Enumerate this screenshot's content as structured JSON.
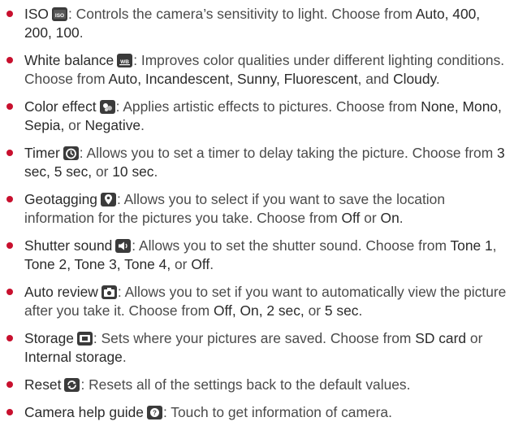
{
  "items": [
    {
      "term": "ISO",
      "icon": "iso-icon",
      "segments": [
        {
          "t": ": Controls the camera’s sensitivity to light. Choose from ",
          "b": false
        },
        {
          "t": "Auto, 400, 200, 100",
          "b": true
        },
        {
          "t": ".",
          "b": false
        }
      ]
    },
    {
      "term": "White balance",
      "icon": "white-balance-icon",
      "segments": [
        {
          "t": ": Improves color qualities under different lighting conditions. Choose from ",
          "b": false
        },
        {
          "t": "Auto, Incandescent, Sunny, Fluorescent",
          "b": true
        },
        {
          "t": ", and ",
          "b": false
        },
        {
          "t": "Cloudy",
          "b": true
        },
        {
          "t": ".",
          "b": false
        }
      ]
    },
    {
      "term": "Color effect",
      "icon": "color-effect-icon",
      "segments": [
        {
          "t": ": Applies artistic effects to pictures. Choose from ",
          "b": false
        },
        {
          "t": "None, Mono, Sepia,",
          "b": true
        },
        {
          "t": " or ",
          "b": false
        },
        {
          "t": "Negative",
          "b": true
        },
        {
          "t": ".",
          "b": false
        }
      ]
    },
    {
      "term": "Timer",
      "icon": "timer-icon",
      "segments": [
        {
          "t": ": Allows you to set a timer to delay taking the picture. Choose from ",
          "b": false
        },
        {
          "t": "3 sec, 5 sec,",
          "b": true
        },
        {
          "t": " or ",
          "b": false
        },
        {
          "t": "10 sec",
          "b": true
        },
        {
          "t": ".",
          "b": false
        }
      ]
    },
    {
      "term": "Geotagging",
      "icon": "geotagging-icon",
      "segments": [
        {
          "t": ": Allows you to select if you want to save the location information for the pictures you take. Choose from ",
          "b": false
        },
        {
          "t": "Off",
          "b": true
        },
        {
          "t": " or ",
          "b": false
        },
        {
          "t": "On",
          "b": true
        },
        {
          "t": ".",
          "b": false
        }
      ]
    },
    {
      "term": "Shutter sound",
      "icon": "shutter-sound-icon",
      "segments": [
        {
          "t": ": Allows you to set the shutter sound. Choose from ",
          "b": false
        },
        {
          "t": "Tone 1",
          "b": true
        },
        {
          "t": ", ",
          "b": false
        },
        {
          "t": "Tone 2, Tone 3, Tone 4,",
          "b": true
        },
        {
          "t": " or ",
          "b": false
        },
        {
          "t": "Off",
          "b": true
        },
        {
          "t": ".",
          "b": false
        }
      ]
    },
    {
      "term": "Auto review",
      "icon": "auto-review-icon",
      "segments": [
        {
          "t": ": Allows you to set if you want to automatically view the picture after you take it. Choose from ",
          "b": false
        },
        {
          "t": "Off, On, 2 sec,",
          "b": true
        },
        {
          "t": " or ",
          "b": false
        },
        {
          "t": "5 sec",
          "b": true
        },
        {
          "t": ".",
          "b": false
        }
      ]
    },
    {
      "term": "Storage",
      "icon": "storage-icon",
      "segments": [
        {
          "t": ": Sets where your pictures are saved. Choose from ",
          "b": false
        },
        {
          "t": "SD card",
          "b": true
        },
        {
          "t": " or ",
          "b": false
        },
        {
          "t": "Internal storage",
          "b": true
        },
        {
          "t": ".",
          "b": false
        }
      ]
    },
    {
      "term": "Reset",
      "icon": "reset-icon",
      "segments": [
        {
          "t": ": Resets all of the settings back to the default values.",
          "b": false
        }
      ]
    },
    {
      "term": "Camera help guide",
      "icon": "help-icon",
      "segments": [
        {
          "t": ": Touch to get information of camera.",
          "b": false
        }
      ]
    }
  ],
  "colors": {
    "bullet": "#c8102e",
    "text": "#4a4a4a",
    "term": "#2b2b2b",
    "icon_bg": "#3b3b3b"
  }
}
